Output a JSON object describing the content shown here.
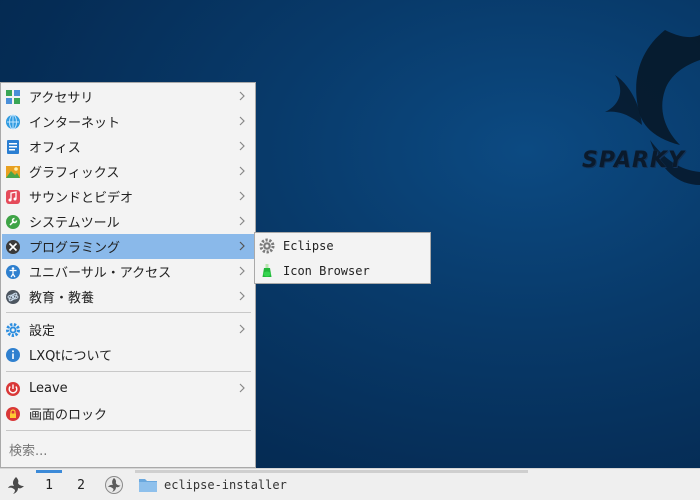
{
  "menu": {
    "items": [
      {
        "label": "アクセサリ",
        "icon": "accessories-icon"
      },
      {
        "label": "インターネット",
        "icon": "internet-icon"
      },
      {
        "label": "オフィス",
        "icon": "office-icon"
      },
      {
        "label": "グラフィックス",
        "icon": "graphics-icon"
      },
      {
        "label": "サウンドとビデオ",
        "icon": "sound-video-icon"
      },
      {
        "label": "システムツール",
        "icon": "system-tools-icon"
      },
      {
        "label": "プログラミング",
        "icon": "programming-icon"
      },
      {
        "label": "ユニバーサル・アクセス",
        "icon": "universal-access-icon"
      },
      {
        "label": "教育・教養",
        "icon": "education-icon"
      }
    ],
    "settings_label": "設定",
    "about_label": "LXQtについて",
    "leave_label": "Leave",
    "lock_label": "画面のロック",
    "search_placeholder": "検索..."
  },
  "submenu": {
    "items": [
      {
        "label": "Eclipse",
        "icon": "eclipse-icon"
      },
      {
        "label": "Icon Browser",
        "icon": "icon-browser-icon"
      }
    ]
  },
  "desktop": {
    "logo_text": "SPARKY"
  },
  "taskbar": {
    "desktop_1": "1",
    "desktop_2": "2",
    "task_label": "eclipse-installer"
  },
  "colors": {
    "highlight": "#8ab9ea",
    "desktop_bg": "#063059",
    "active_indicator": "#3c8ad8"
  }
}
